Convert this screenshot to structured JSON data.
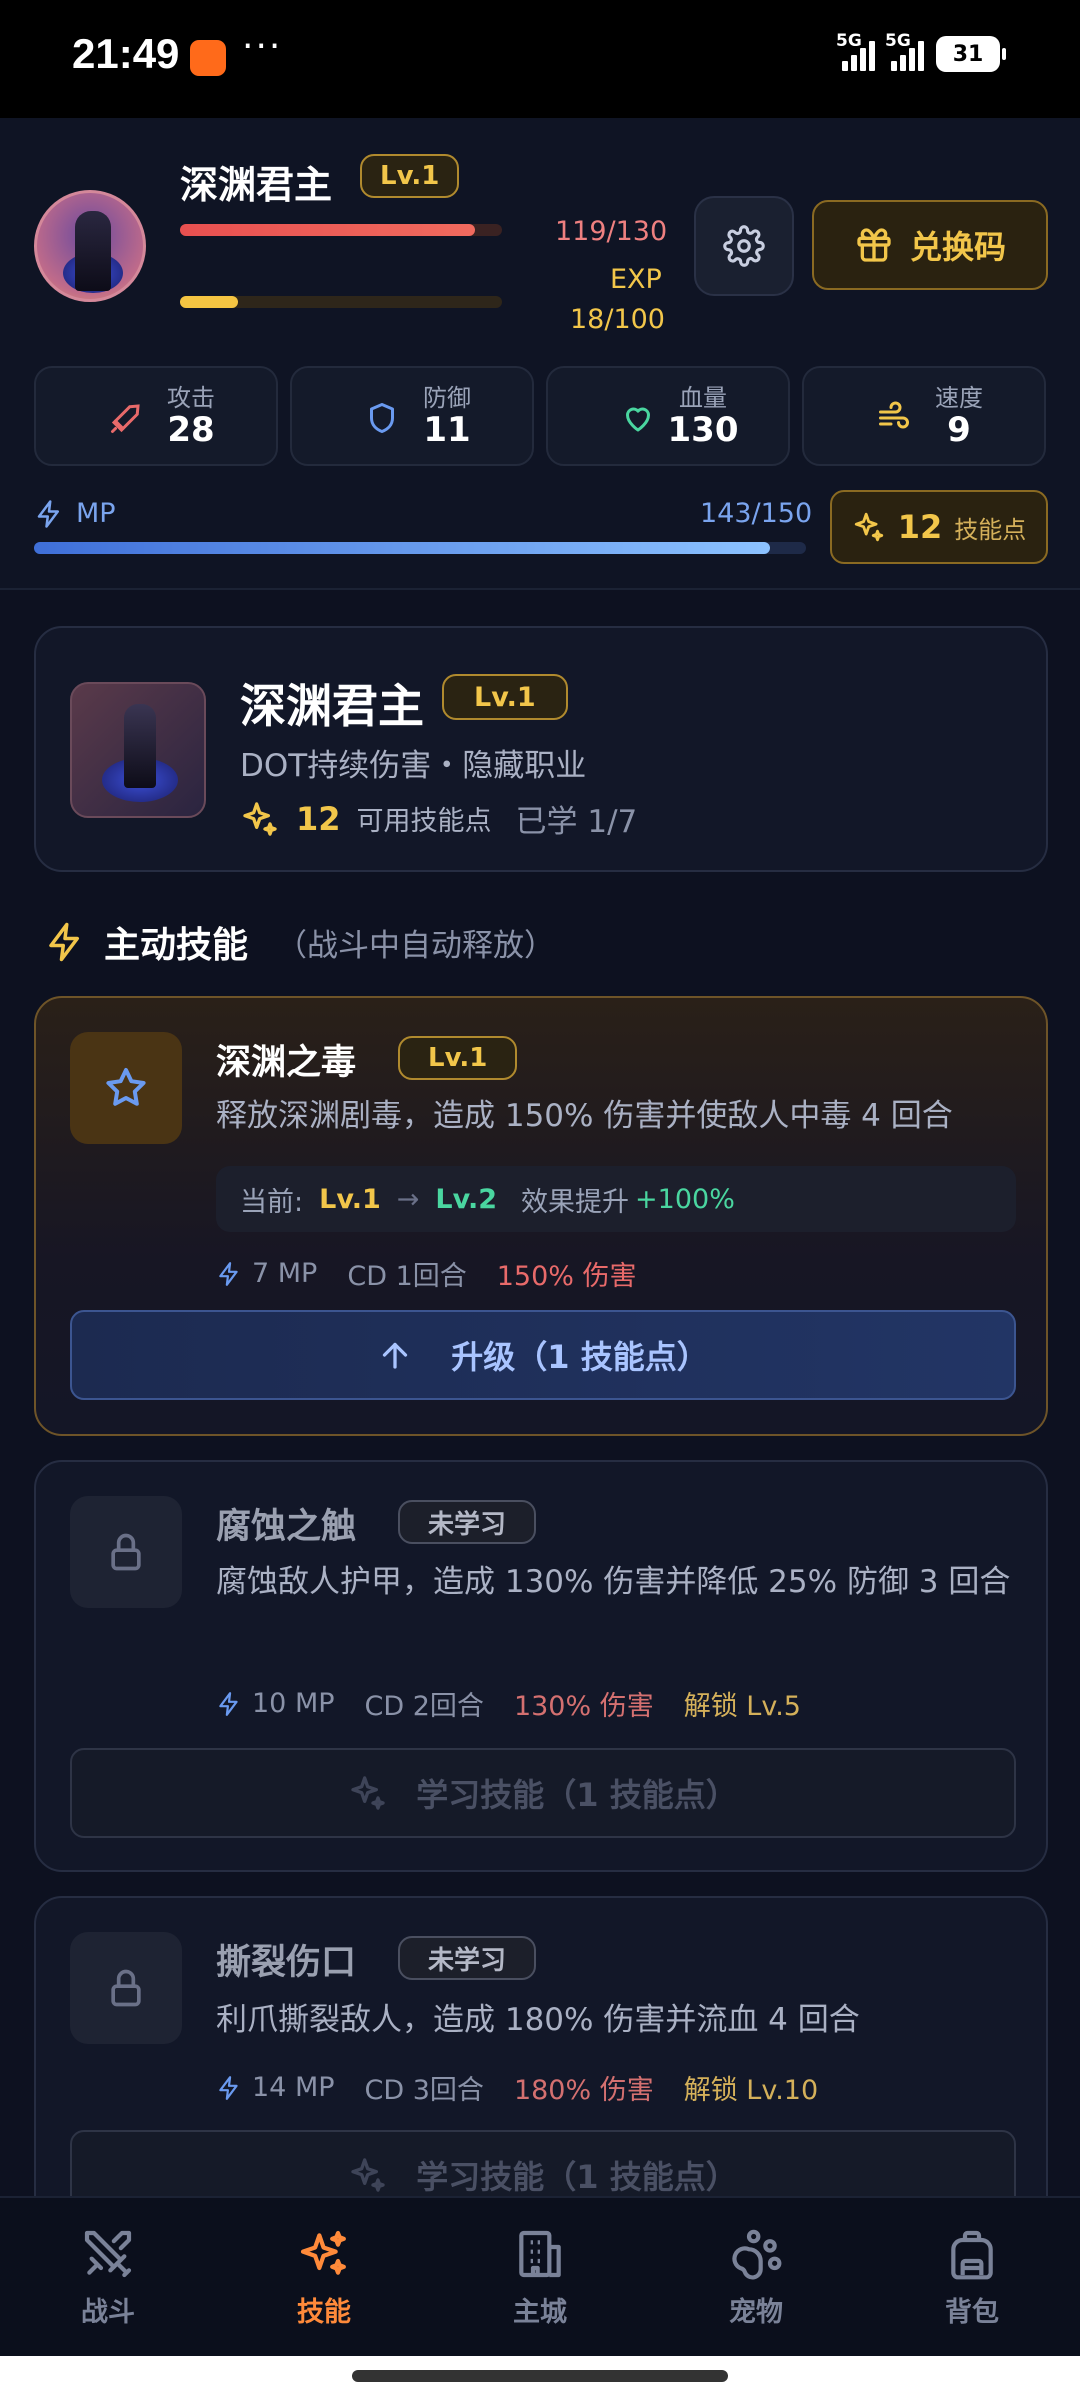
{
  "status_bar": {
    "time": "21:49",
    "more": "···",
    "signal1": "5G",
    "signal2": "5G",
    "battery": "31"
  },
  "header": {
    "name": "深渊君主",
    "level": "Lv.1",
    "hp_text": "119/130",
    "hp_fraction": 0.915,
    "exp_label": "EXP",
    "exp_text": "18/100",
    "exp_fraction": 0.18,
    "redeem_label": "兑换码",
    "stats": [
      {
        "label": "攻击",
        "value": "28",
        "icon": "sword-icon",
        "color": "#e86a6a"
      },
      {
        "label": "防御",
        "value": "11",
        "icon": "shield-icon",
        "color": "#6a9af0"
      },
      {
        "label": "血量",
        "value": "130",
        "icon": "heart-icon",
        "color": "#4ad6a0"
      },
      {
        "label": "速度",
        "value": "9",
        "icon": "wind-icon",
        "color": "#f2c64a"
      }
    ],
    "mp_label": "MP",
    "mp_text": "143/150",
    "mp_fraction": 0.953,
    "skill_points": "12",
    "skill_points_label": "技能点"
  },
  "class_card": {
    "name": "深渊君主",
    "level": "Lv.1",
    "desc": "DOT持续伤害・隐藏职业",
    "points": "12",
    "points_label": "可用技能点",
    "learned": "已学 1/7"
  },
  "section": {
    "title": "主动技能",
    "subtitle": "（战斗中自动释放）"
  },
  "skills": [
    {
      "name": "深渊之毒",
      "tag": "Lv.1",
      "desc": "释放深渊剧毒，造成 150% 伤害并使敌人中毒 4 回合",
      "current_label": "当前:",
      "current_lv": "Lv.1",
      "arrow": "→",
      "next_lv": "Lv.2",
      "effect_label": "效果提升",
      "effect_value": "+100%",
      "mp": "7 MP",
      "cd": "CD 1回合",
      "damage": "150% 伤害",
      "button": "升级（1 技能点）"
    },
    {
      "name": "腐蚀之触",
      "tag": "未学习",
      "desc": "腐蚀敌人护甲，造成 130% 伤害并降低 25% 防御 3 回合",
      "mp": "10 MP",
      "cd": "CD 2回合",
      "damage": "130% 伤害",
      "unlock": "解锁 Lv.5",
      "button": "学习技能（1 技能点）"
    },
    {
      "name": "撕裂伤口",
      "tag": "未学习",
      "desc": "利爪撕裂敌人，造成 180% 伤害并流血 4 回合",
      "mp": "14 MP",
      "cd": "CD 3回合",
      "damage": "180% 伤害",
      "unlock": "解锁 Lv.10",
      "button": "学习技能（1 技能点）"
    }
  ],
  "nav": [
    {
      "label": "战斗",
      "icon": "swords-icon"
    },
    {
      "label": "技能",
      "icon": "sparkles-icon",
      "active": true
    },
    {
      "label": "主城",
      "icon": "building-icon"
    },
    {
      "label": "宠物",
      "icon": "paw-icon"
    },
    {
      "label": "背包",
      "icon": "backpack-icon"
    }
  ],
  "colors": {
    "accent": "#f2c64a",
    "active_nav": "#ff8a3a",
    "bg": "#0d1120",
    "mp": "#7aa4ee",
    "hp": "#e85050"
  }
}
